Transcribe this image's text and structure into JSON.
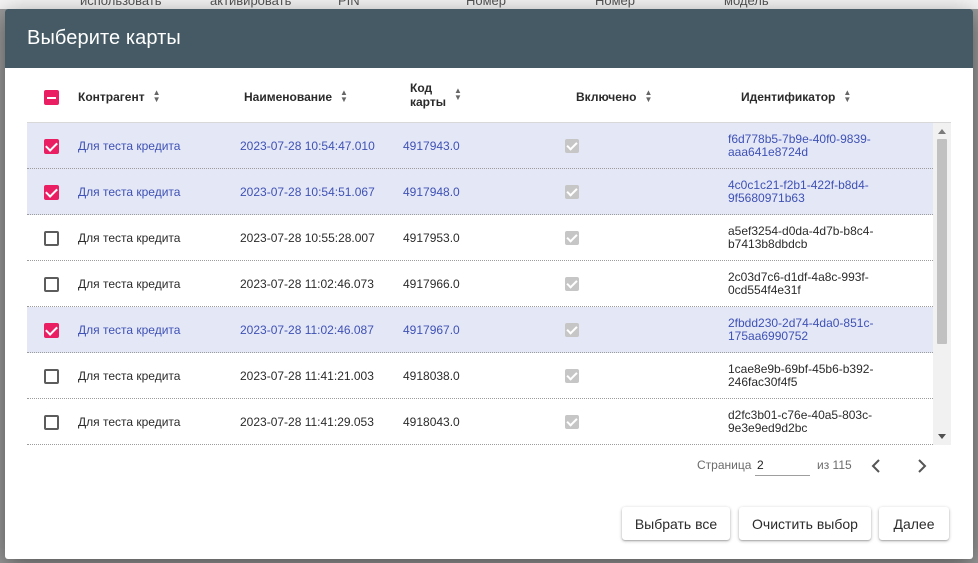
{
  "background": {
    "columns": [
      "использовать",
      "активировать",
      "PIN",
      "Номер",
      "Номер",
      "модель"
    ]
  },
  "modal": {
    "title": "Выберите карты"
  },
  "table": {
    "headers": {
      "counterparty": "Контрагент",
      "name": "Наименование",
      "card_code_line1": "Код",
      "card_code_line2": "карты",
      "enabled": "Включено",
      "identifier": "Идентификатор"
    },
    "rows": [
      {
        "selected": true,
        "counterparty": "Для теста кредита",
        "name": "2023-07-28 10:54:47.010",
        "code": "4917943.0",
        "id": "f6d778b5-7b9e-40f0-9839-aaa641e8724d"
      },
      {
        "selected": true,
        "counterparty": "Для теста кредита",
        "name": "2023-07-28 10:54:51.067",
        "code": "4917948.0",
        "id": "4c0c1c21-f2b1-422f-b8d4-9f5680971b63"
      },
      {
        "selected": false,
        "counterparty": "Для теста кредита",
        "name": "2023-07-28 10:55:28.007",
        "code": "4917953.0",
        "id": "a5ef3254-d0da-4d7b-b8c4-b7413b8dbdcb"
      },
      {
        "selected": false,
        "counterparty": "Для теста кредита",
        "name": "2023-07-28 11:02:46.073",
        "code": "4917966.0",
        "id": "2c03d7c6-d1df-4a8c-993f-0cd554f4e31f"
      },
      {
        "selected": true,
        "counterparty": "Для теста кредита",
        "name": "2023-07-28 11:02:46.087",
        "code": "4917967.0",
        "id": "2fbdd230-2d74-4da0-851c-175aa6990752"
      },
      {
        "selected": false,
        "counterparty": "Для теста кредита",
        "name": "2023-07-28 11:41:21.003",
        "code": "4918038.0",
        "id": "1cae8e9b-69bf-45b6-b392-246fac30f4f5"
      },
      {
        "selected": false,
        "counterparty": "Для теста кредита",
        "name": "2023-07-28 11:41:29.053",
        "code": "4918043.0",
        "id": "d2fc3b01-c76e-40a5-803c-9e3e9ed9d2bc"
      }
    ]
  },
  "pagination": {
    "label": "Страница",
    "current": "2",
    "total": "из 115"
  },
  "buttons": {
    "select_all": "Выбрать все",
    "clear": "Очистить выбор",
    "next": "Далее"
  },
  "colors": {
    "header_bg": "#455a64",
    "accent": "#e91e63",
    "selected_row": "#e4e8f6",
    "selected_text": "#3f51b5"
  },
  "icons": {
    "sort": "sort-arrows-icon",
    "prev": "chevron-left-icon",
    "next": "chevron-right-icon"
  }
}
